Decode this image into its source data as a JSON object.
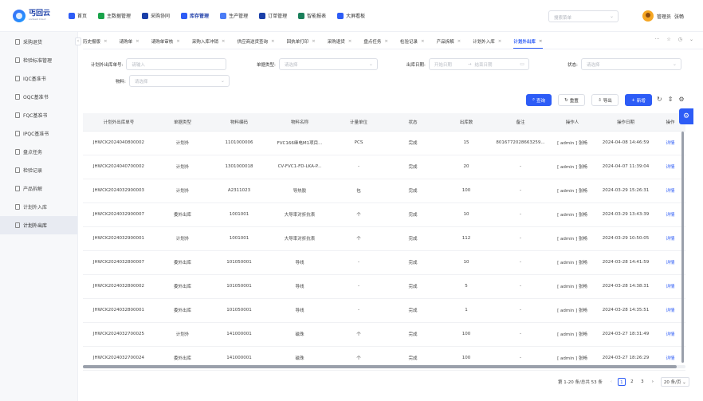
{
  "app": {
    "logo_text": "丐回云",
    "logo_sub": "Lonbest Cloud"
  },
  "topnav": {
    "items": [
      {
        "label": "首页",
        "color": "#2d5cf6"
      },
      {
        "label": "主数据管理",
        "color": "#1aa34a"
      },
      {
        "label": "采购协同",
        "color": "#1a3fa8"
      },
      {
        "label": "库存管理",
        "color": "#2d5cf6",
        "active": true
      },
      {
        "label": "生产管理",
        "color": "#4a7cf6"
      },
      {
        "label": "订单管理",
        "color": "#1a3fa8"
      },
      {
        "label": "智能报表",
        "color": "#1a7f5a"
      },
      {
        "label": "大屏看板",
        "color": "#2d5cf6"
      }
    ],
    "search_placeholder": "搜索菜单",
    "user_name": "管理员",
    "user_role": "张畅"
  },
  "sidebar": {
    "items": [
      {
        "label": "采购退货"
      },
      {
        "label": "检验标准管理"
      },
      {
        "label": "IQC基准书"
      },
      {
        "label": "OQC基准书"
      },
      {
        "label": "FQC基准书"
      },
      {
        "label": "IPQC基准书"
      },
      {
        "label": "盘点任务"
      },
      {
        "label": "检验记录"
      },
      {
        "label": "产品拆解"
      },
      {
        "label": "计划外入库"
      },
      {
        "label": "计划外出库",
        "active": true
      }
    ]
  },
  "tabs": [
    {
      "label": "历史报版"
    },
    {
      "label": "请购单"
    },
    {
      "label": "请购单审核"
    },
    {
      "label": "采购入库冲销"
    },
    {
      "label": "供应商送货查询"
    },
    {
      "label": "回执单打印"
    },
    {
      "label": "采购退货"
    },
    {
      "label": "盘点任务"
    },
    {
      "label": "检验记录"
    },
    {
      "label": "产品拆解"
    },
    {
      "label": "计划外入库"
    },
    {
      "label": "计划外出库",
      "active": true
    }
  ],
  "filters": {
    "order_no_label": "计划外出库单号:",
    "order_no_placeholder": "请输入",
    "type_label": "单据类型:",
    "type_placeholder": "请选择",
    "date_label": "出库日期:",
    "date_start": "开始日期",
    "date_sep": "→",
    "date_end": "结束日期",
    "status_label": "状态:",
    "status_placeholder": "请选择",
    "material_label": "物料:",
    "material_placeholder": "请选择"
  },
  "actions": {
    "query": "查询",
    "reset": "重置",
    "export": "导出",
    "add": "新增"
  },
  "table": {
    "columns": [
      "计划外出库单号",
      "单据类型",
      "物料编码",
      "物料名称",
      "计量单位",
      "状态",
      "出库数",
      "备注",
      "操作人",
      "操作日期",
      "操作"
    ],
    "rows": [
      [
        "JHWCK2024040800002",
        "计划外",
        "1101000006",
        "FVC166继电M1项目...",
        "PCS",
        "完成",
        "15",
        "8016772028663259...",
        "[ admin ] 张畅",
        "2024-04-08 14:46:59",
        "详情"
      ],
      [
        "JHWCK2024040700002",
        "计划外",
        "1301000018",
        "CV-FVC1-FD-LKA-P...",
        "-",
        "完成",
        "20",
        "-",
        "[ admin ] 张畅",
        "2024-04-07 11:39:04",
        "详情"
      ],
      [
        "JHWCK2024032900003",
        "计划外",
        "A2311023",
        "导热胶",
        "包",
        "完成",
        "100",
        "-",
        "[ admin ] 张畅",
        "2024-03-29 15:26:31",
        "详情"
      ],
      [
        "JHWCK2024032900007",
        "委外出库",
        "1001001",
        "大导率对折抗表",
        "个",
        "完成",
        "10",
        "-",
        "[ admin ] 张畅",
        "2024-03-29 13:43:39",
        "详情"
      ],
      [
        "JHWCK2024032900001",
        "计划外",
        "1001001",
        "大导率对折抗表",
        "个",
        "完成",
        "112",
        "-",
        "[ admin ] 张畅",
        "2024-03-29 10:50:05",
        "详情"
      ],
      [
        "JHWCK2024032800007",
        "委外出库",
        "101050001",
        "导线",
        "-",
        "完成",
        "10",
        "-",
        "[ admin ] 张畅",
        "2024-03-28 14:41:59",
        "详情"
      ],
      [
        "JHWCK2024032800002",
        "委外出库",
        "101050001",
        "导线",
        "-",
        "完成",
        "5",
        "-",
        "[ admin ] 张畅",
        "2024-03-28 14:38:31",
        "详情"
      ],
      [
        "JHWCK2024032800001",
        "委外出库",
        "101050001",
        "导线",
        "-",
        "完成",
        "1",
        "-",
        "[ admin ] 张畅",
        "2024-03-28 14:35:51",
        "详情"
      ],
      [
        "JHWCK2024032700025",
        "计划外",
        "141000001",
        "磁珠",
        "个",
        "完成",
        "100",
        "-",
        "[ admin ] 张畅",
        "2024-03-27 18:31:49",
        "详情"
      ],
      [
        "JHWCK2024032700024",
        "委外出库",
        "141000001",
        "磁珠",
        "个",
        "完成",
        "100",
        "-",
        "[ admin ] 张畅",
        "2024-03-27 18:26:29",
        "详情"
      ]
    ]
  },
  "pager": {
    "summary": "第 1-20 条/总共 53 条",
    "pages": [
      "1",
      "2",
      "3"
    ],
    "page_size": "20 条/页"
  }
}
